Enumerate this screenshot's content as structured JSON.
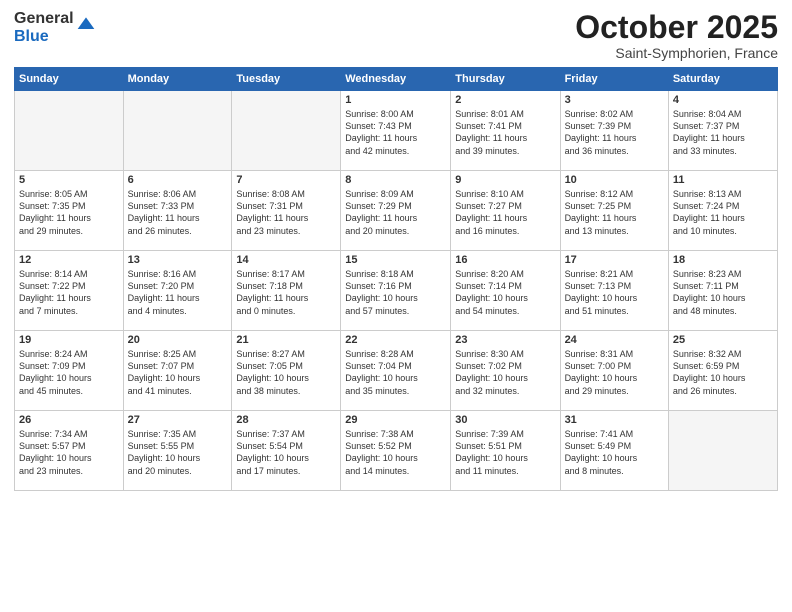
{
  "logo": {
    "general": "General",
    "blue": "Blue"
  },
  "calendar": {
    "title": "October 2025",
    "subtitle": "Saint-Symphorien, France"
  },
  "weekdays": [
    "Sunday",
    "Monday",
    "Tuesday",
    "Wednesday",
    "Thursday",
    "Friday",
    "Saturday"
  ],
  "weeks": [
    [
      {
        "day": "",
        "info": ""
      },
      {
        "day": "",
        "info": ""
      },
      {
        "day": "",
        "info": ""
      },
      {
        "day": "1",
        "info": "Sunrise: 8:00 AM\nSunset: 7:43 PM\nDaylight: 11 hours\nand 42 minutes."
      },
      {
        "day": "2",
        "info": "Sunrise: 8:01 AM\nSunset: 7:41 PM\nDaylight: 11 hours\nand 39 minutes."
      },
      {
        "day": "3",
        "info": "Sunrise: 8:02 AM\nSunset: 7:39 PM\nDaylight: 11 hours\nand 36 minutes."
      },
      {
        "day": "4",
        "info": "Sunrise: 8:04 AM\nSunset: 7:37 PM\nDaylight: 11 hours\nand 33 minutes."
      }
    ],
    [
      {
        "day": "5",
        "info": "Sunrise: 8:05 AM\nSunset: 7:35 PM\nDaylight: 11 hours\nand 29 minutes."
      },
      {
        "day": "6",
        "info": "Sunrise: 8:06 AM\nSunset: 7:33 PM\nDaylight: 11 hours\nand 26 minutes."
      },
      {
        "day": "7",
        "info": "Sunrise: 8:08 AM\nSunset: 7:31 PM\nDaylight: 11 hours\nand 23 minutes."
      },
      {
        "day": "8",
        "info": "Sunrise: 8:09 AM\nSunset: 7:29 PM\nDaylight: 11 hours\nand 20 minutes."
      },
      {
        "day": "9",
        "info": "Sunrise: 8:10 AM\nSunset: 7:27 PM\nDaylight: 11 hours\nand 16 minutes."
      },
      {
        "day": "10",
        "info": "Sunrise: 8:12 AM\nSunset: 7:25 PM\nDaylight: 11 hours\nand 13 minutes."
      },
      {
        "day": "11",
        "info": "Sunrise: 8:13 AM\nSunset: 7:24 PM\nDaylight: 11 hours\nand 10 minutes."
      }
    ],
    [
      {
        "day": "12",
        "info": "Sunrise: 8:14 AM\nSunset: 7:22 PM\nDaylight: 11 hours\nand 7 minutes."
      },
      {
        "day": "13",
        "info": "Sunrise: 8:16 AM\nSunset: 7:20 PM\nDaylight: 11 hours\nand 4 minutes."
      },
      {
        "day": "14",
        "info": "Sunrise: 8:17 AM\nSunset: 7:18 PM\nDaylight: 11 hours\nand 0 minutes."
      },
      {
        "day": "15",
        "info": "Sunrise: 8:18 AM\nSunset: 7:16 PM\nDaylight: 10 hours\nand 57 minutes."
      },
      {
        "day": "16",
        "info": "Sunrise: 8:20 AM\nSunset: 7:14 PM\nDaylight: 10 hours\nand 54 minutes."
      },
      {
        "day": "17",
        "info": "Sunrise: 8:21 AM\nSunset: 7:13 PM\nDaylight: 10 hours\nand 51 minutes."
      },
      {
        "day": "18",
        "info": "Sunrise: 8:23 AM\nSunset: 7:11 PM\nDaylight: 10 hours\nand 48 minutes."
      }
    ],
    [
      {
        "day": "19",
        "info": "Sunrise: 8:24 AM\nSunset: 7:09 PM\nDaylight: 10 hours\nand 45 minutes."
      },
      {
        "day": "20",
        "info": "Sunrise: 8:25 AM\nSunset: 7:07 PM\nDaylight: 10 hours\nand 41 minutes."
      },
      {
        "day": "21",
        "info": "Sunrise: 8:27 AM\nSunset: 7:05 PM\nDaylight: 10 hours\nand 38 minutes."
      },
      {
        "day": "22",
        "info": "Sunrise: 8:28 AM\nSunset: 7:04 PM\nDaylight: 10 hours\nand 35 minutes."
      },
      {
        "day": "23",
        "info": "Sunrise: 8:30 AM\nSunset: 7:02 PM\nDaylight: 10 hours\nand 32 minutes."
      },
      {
        "day": "24",
        "info": "Sunrise: 8:31 AM\nSunset: 7:00 PM\nDaylight: 10 hours\nand 29 minutes."
      },
      {
        "day": "25",
        "info": "Sunrise: 8:32 AM\nSunset: 6:59 PM\nDaylight: 10 hours\nand 26 minutes."
      }
    ],
    [
      {
        "day": "26",
        "info": "Sunrise: 7:34 AM\nSunset: 5:57 PM\nDaylight: 10 hours\nand 23 minutes."
      },
      {
        "day": "27",
        "info": "Sunrise: 7:35 AM\nSunset: 5:55 PM\nDaylight: 10 hours\nand 20 minutes."
      },
      {
        "day": "28",
        "info": "Sunrise: 7:37 AM\nSunset: 5:54 PM\nDaylight: 10 hours\nand 17 minutes."
      },
      {
        "day": "29",
        "info": "Sunrise: 7:38 AM\nSunset: 5:52 PM\nDaylight: 10 hours\nand 14 minutes."
      },
      {
        "day": "30",
        "info": "Sunrise: 7:39 AM\nSunset: 5:51 PM\nDaylight: 10 hours\nand 11 minutes."
      },
      {
        "day": "31",
        "info": "Sunrise: 7:41 AM\nSunset: 5:49 PM\nDaylight: 10 hours\nand 8 minutes."
      },
      {
        "day": "",
        "info": ""
      }
    ]
  ]
}
